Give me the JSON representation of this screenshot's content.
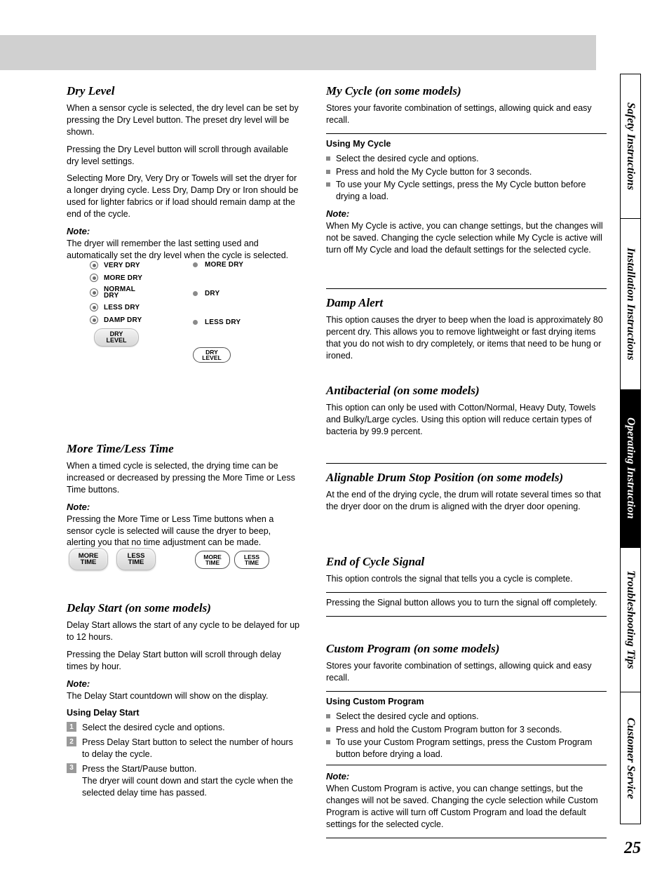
{
  "banner_label": "",
  "tabs": {
    "safety": "Safety Instructions",
    "installation": "Installation Instructions",
    "operating": "Operating Instruction",
    "troubleshooting": "Troubleshooting Tips",
    "customer": "Customer Service"
  },
  "page_number": "25",
  "dryLevel": {
    "heading": "Dry Level",
    "intro": "When a sensor cycle is selected, the dry level can be set by pressing the Dry Level button. The preset dry level will be shown.",
    "para2": "Pressing the Dry Level button will scroll through available dry level settings.",
    "para3": "Selecting More Dry, Very Dry or Towels will set the dryer for a longer drying cycle. Less Dry, Damp Dry or Iron should be used for lighter fabrics or if load should remain damp at the end of the cycle.",
    "note_label": "Note:",
    "note_text": "The dryer will remember the last setting used and automatically set the dry level when the cycle is selected.",
    "panel5": {
      "items": [
        "VERY DRY",
        "MORE DRY",
        "NORMAL\nDRY",
        "LESS DRY",
        "DAMP DRY"
      ],
      "button": "DRY\nLEVEL"
    },
    "panel3": {
      "items": [
        "MORE DRY",
        "DRY",
        "LESS DRY"
      ],
      "button": "DRY\nLEVEL"
    }
  },
  "moreLess": {
    "heading": "More Time/Less Time",
    "para1": "When a timed cycle is selected, the drying time can be increased or decreased by pressing the More Time or Less Time buttons.",
    "note_label": "Note:",
    "note_text": "Pressing the More Time or Less Time buttons when a sensor cycle is selected will cause the dryer to beep, alerting you that no time adjustment can be made.",
    "btn_more_emb": "MORE\nTIME",
    "btn_less_emb": "LESS\nTIME",
    "btn_more_out": "MORE\nTIME",
    "btn_less_out": "LESS\nTIME"
  },
  "delay": {
    "heading": "Delay Start (on some models)",
    "para1": "Delay Start allows the start of any cycle to be delayed for up to 12 hours.",
    "para2": "Pressing the Delay Start button will scroll through delay times by hour.",
    "note_label": "Note:",
    "note_text": "The Delay Start countdown will show on the display.",
    "para3": "Using Delay Start",
    "s1": "Select the desired cycle and options.",
    "s2": "Press Delay Start button to select the number of hours to delay the cycle.",
    "s3a": "Press the Start/Pause button.",
    "s3b": "The dryer will count down and start the cycle when the selected delay time has passed."
  },
  "myCycle": {
    "heading": "My Cycle (on some models)",
    "para1": "Stores your favorite combination of settings, allowing quick and easy recall.",
    "para2": "Using My Cycle",
    "s1": "Select the desired cycle and options.",
    "s2": "Press and hold the My Cycle button for 3 seconds.",
    "s3": "To use your My Cycle settings, press the My Cycle button before drying a load.",
    "note_label": "Note:",
    "note_text": "When My Cycle is active, you can change settings, but the changes will not be saved. Changing the cycle selection while My Cycle is active will turn off My Cycle and load the default settings for the selected cycle."
  },
  "damp": {
    "heading": "Damp Alert",
    "text": "This option causes the dryer to beep when the load is approximately 80 percent dry. This allows you to remove lightweight or fast drying items that you do not wish to dry completely, or items that need to be hung or ironed."
  },
  "antibac": {
    "heading": "Antibacterial (on some models)",
    "text": "This option can only be used with Cotton/Normal, Heavy Duty, Towels and Bulky/Large cycles. Using this option will reduce certain types of bacteria by 99.9 percent."
  },
  "align": {
    "heading": "Alignable Drum Stop Position (on some models)",
    "text": "At the end of the drying cycle, the drum will rotate several times so that the dryer door on the drum is aligned with the dryer door opening."
  },
  "endCycle": {
    "heading": "End of Cycle Signal",
    "para1": "This option controls the signal that tells you a cycle is complete.",
    "para2": "Pressing the Signal button allows you to turn the signal off completely."
  },
  "customProg": {
    "heading": "Custom Program (on some models)",
    "para1": "Stores your favorite combination of settings, allowing quick and easy recall.",
    "using": "Using Custom Program",
    "b1": "Select the desired cycle and options.",
    "b2": "Press and hold the Custom Program button for 3 seconds.",
    "b3": "To use your Custom Program settings, press the Custom Program button before drying a load.",
    "note_label": "Note:",
    "note_text": "When Custom Program is active, you can change settings, but the changes will not be saved. Changing the cycle selection while Custom Program is active will turn off Custom Program and load the default settings for the selected cycle."
  }
}
